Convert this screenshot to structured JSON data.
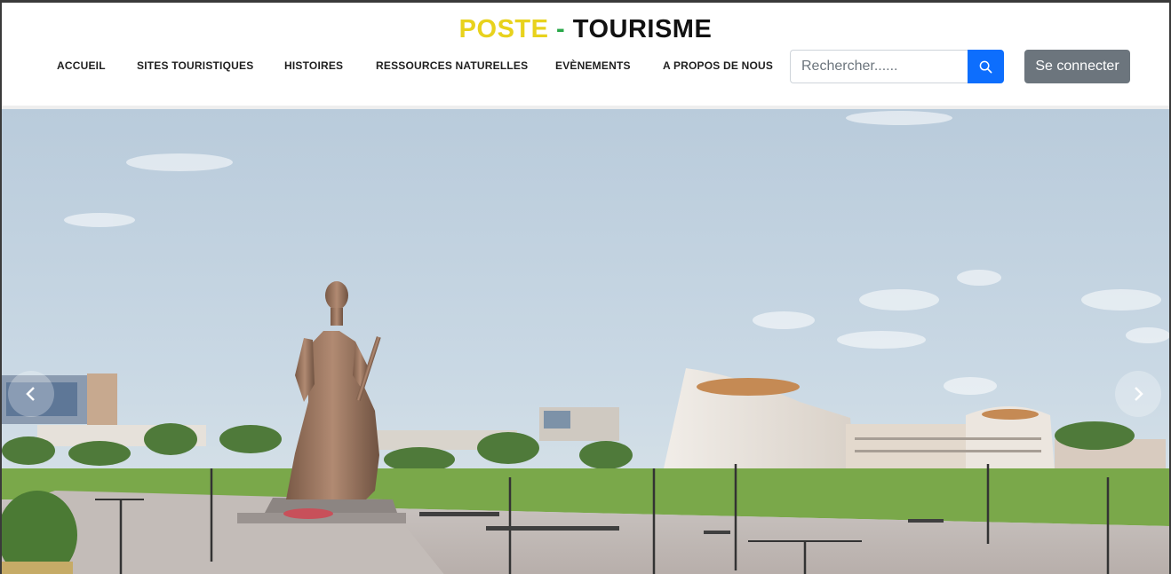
{
  "brand": {
    "word1": "POSTE",
    "separator": " - ",
    "word2": "TOURISME"
  },
  "colors": {
    "brand_yellow": "#e8d21d",
    "brand_green": "#2aa84a",
    "search_button": "#0d6efd",
    "login_button": "#6c757d"
  },
  "nav": {
    "items": [
      {
        "label": "ACCUEIL"
      },
      {
        "label": "SITES TOURISTIQUES"
      },
      {
        "label": "HISTOIRES"
      },
      {
        "label": "RESSOURCES NATURELLES"
      },
      {
        "label": "EVÈNEMENTS"
      },
      {
        "label": "A PROPOS DE NOUS"
      }
    ]
  },
  "search": {
    "placeholder": "Rechercher......",
    "value": "",
    "icon": "search-icon"
  },
  "auth": {
    "login_label": "Se connecter"
  },
  "hero": {
    "image": "photo of a large bronze female warrior statue on a plaza with modern buildings",
    "prev_icon": "chevron-left-icon",
    "next_icon": "chevron-right-icon"
  }
}
